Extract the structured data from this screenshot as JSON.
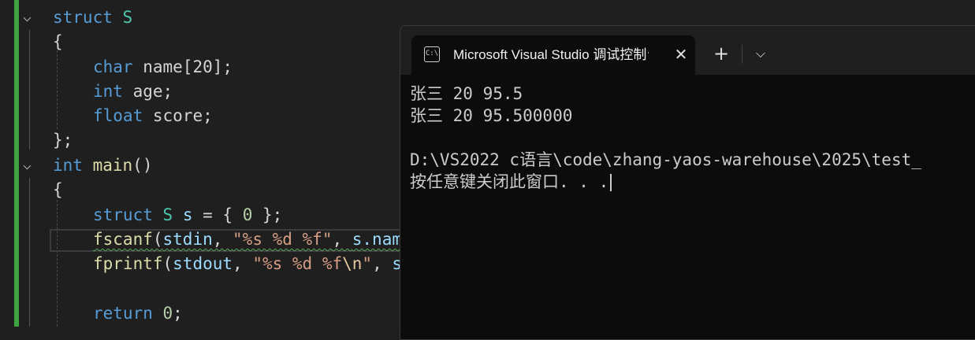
{
  "editor": {
    "struct_kw": "struct",
    "struct_name": "S",
    "open_brace": "{",
    "close_brace_semi": "};",
    "char_kw": "char",
    "name_decl": "name[20];",
    "int_kw": "int",
    "age_decl": "age;",
    "float_kw": "float",
    "score_decl": "score;",
    "main_fn": "main",
    "main_parens": "()",
    "s_var": "s",
    "init": "= { 0 };",
    "init_zero": "0",
    "fscanf_fn": "fscanf",
    "stdin": "stdin",
    "fmt_in": "\"%s %d %f\"",
    "s_name": "s.nam",
    "fprintf_fn": "fprintf",
    "stdout": "stdout",
    "fmt_out_a": "\"%s %d %f",
    "fmt_out_esc": "\\n",
    "fmt_out_b": "\"",
    "s_trunc": "s",
    "return_kw": "return",
    "return_val": "0"
  },
  "console": {
    "tab_icon": "C:\\",
    "tab_title": "Microsoft Visual Studio 调试控制台",
    "close_glyph": "✕",
    "new_tab_glyph": "+",
    "dropdown_glyph": "⌵",
    "lines": [
      "张三 20 95.5",
      "张三 20 95.500000",
      "",
      "D:\\VS2022 c语言\\code\\zhang-yaos-warehouse\\2025\\test_",
      "按任意键关闭此窗口. . ."
    ]
  }
}
